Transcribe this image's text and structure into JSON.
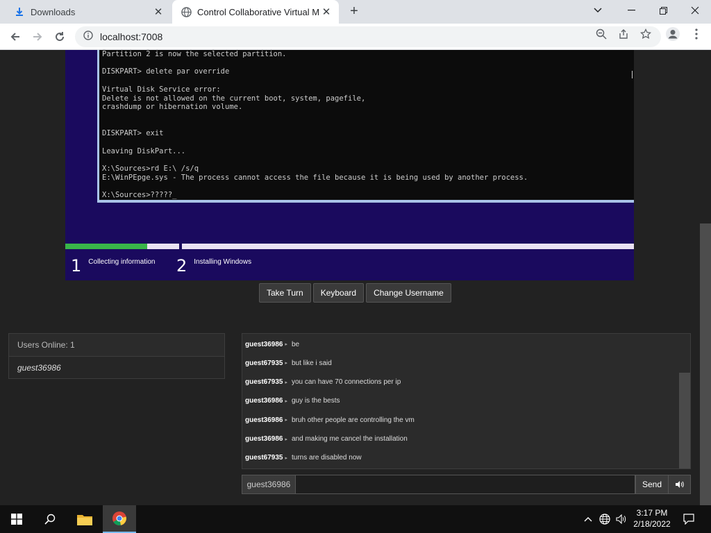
{
  "browser": {
    "tabs": [
      {
        "title": "Downloads",
        "icon": "download-icon",
        "active": false
      },
      {
        "title": "Control Collaborative Virtual Mac",
        "icon": "globe-icon",
        "active": true
      }
    ],
    "url": "localhost:7008"
  },
  "vm": {
    "console_lines": [
      "Partition 2 is now the selected partition.",
      "",
      "DISKPART> delete par override",
      "",
      "Virtual Disk Service error:",
      "Delete is not allowed on the current boot, system, pagefile,",
      "crashdump or hibernation volume.",
      "",
      "",
      "DISKPART> exit",
      "",
      "Leaving DiskPart...",
      "",
      "X:\\Sources>rd E:\\ /s/q",
      "E:\\WinPEpge.sys - The process cannot access the file because it is being used by another process.",
      "",
      "X:\\Sources>?????_"
    ],
    "setup_progress": 0.72,
    "steps": [
      {
        "number": "1",
        "label": "Collecting information"
      },
      {
        "number": "2",
        "label": "Installing Windows"
      }
    ],
    "buttons": {
      "take_turn": "Take Turn",
      "keyboard": "Keyboard",
      "change_username": "Change Username"
    }
  },
  "users": {
    "header": "Users Online: 1",
    "list": [
      "guest36986"
    ]
  },
  "chat": {
    "messages": [
      {
        "user": "guest36986",
        "text": "be"
      },
      {
        "user": "guest67935",
        "text": "but like i said"
      },
      {
        "user": "guest67935",
        "text": "you can have 70 connections per ip"
      },
      {
        "user": "guest36986",
        "text": "guy is the bests"
      },
      {
        "user": "guest36986",
        "text": "bruh other people are controlling the vm"
      },
      {
        "user": "guest36986",
        "text": "and making me cancel the installation"
      },
      {
        "user": "guest67935",
        "text": "turns are disabled now"
      }
    ],
    "username": "guest36986",
    "input_value": "",
    "send_label": "Send",
    "sound_icon": "speaker-icon"
  },
  "taskbar": {
    "time": "3:17 PM",
    "date": "2/18/2022"
  },
  "colors": {
    "vm_background": "#1a0a5e",
    "progress_fill": "#39b54a",
    "page_background": "#222222"
  }
}
